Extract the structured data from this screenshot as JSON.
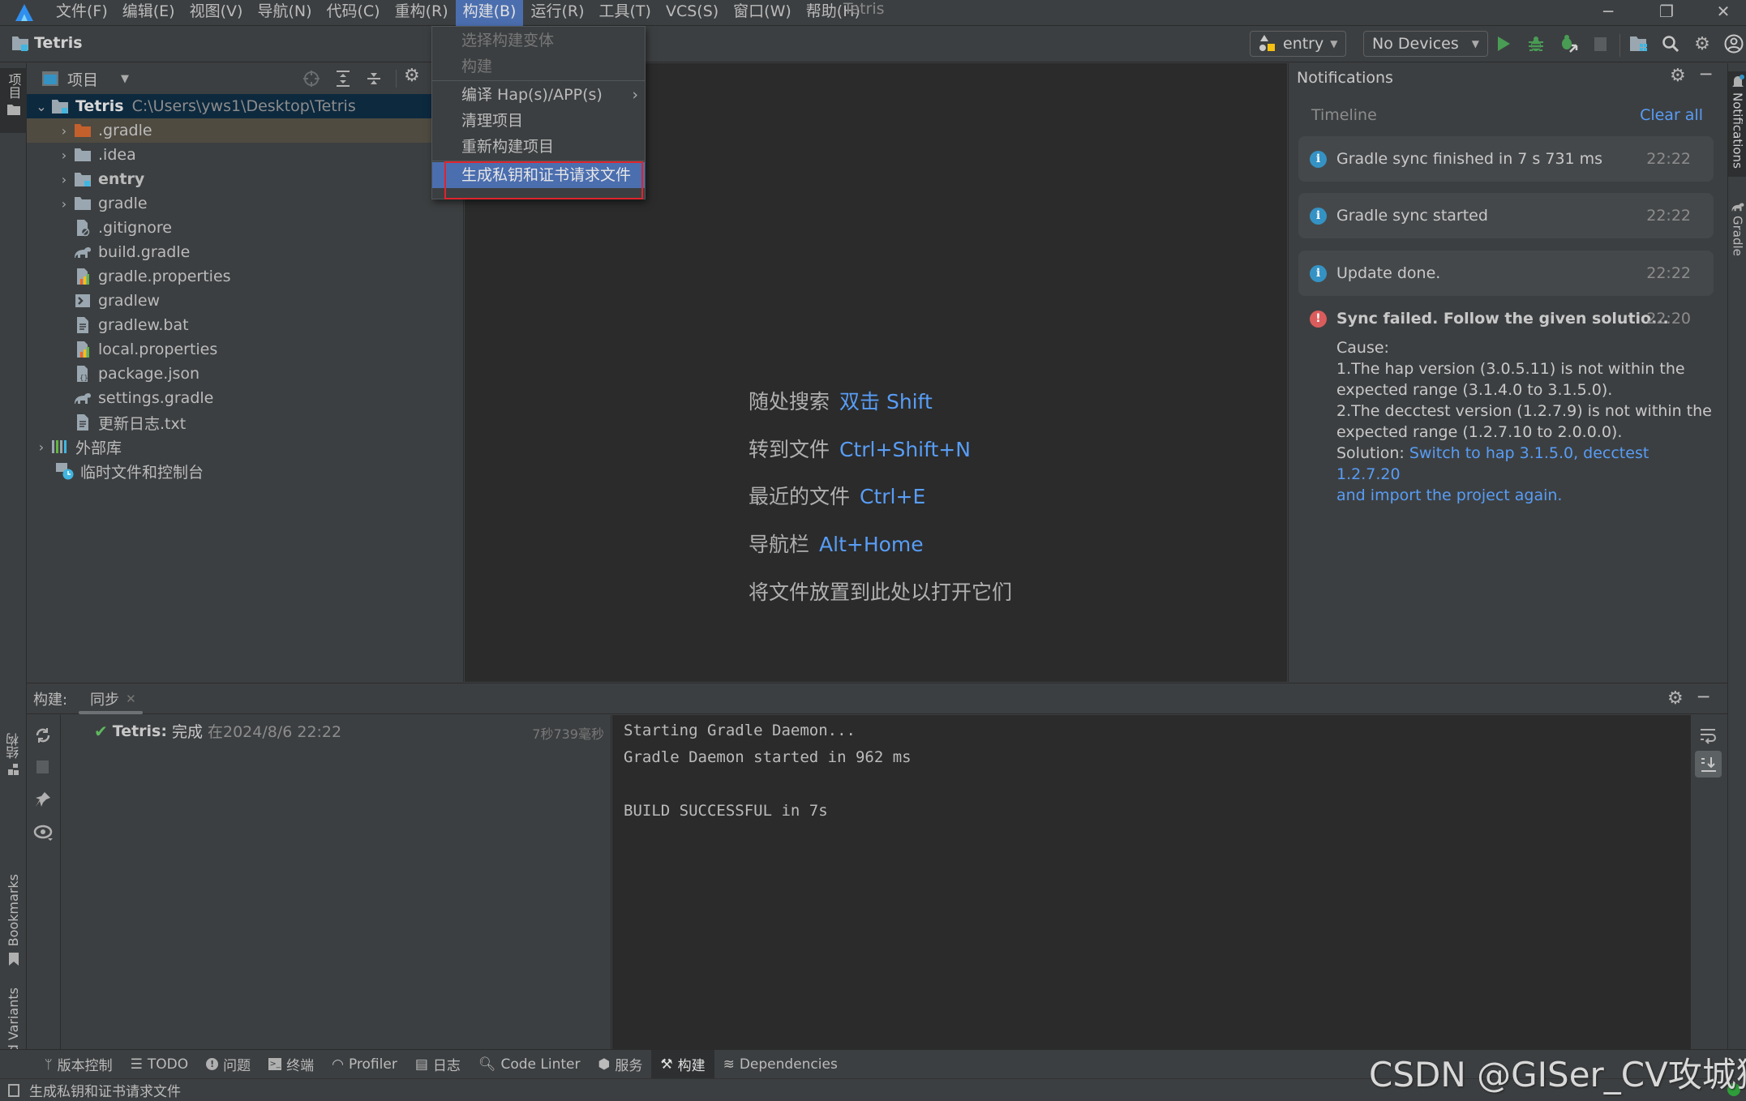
{
  "menubar": {
    "items": [
      "文件(F)",
      "编辑(E)",
      "视图(V)",
      "导航(N)",
      "代码(C)",
      "重构(R)",
      "构建(B)",
      "运行(R)",
      "工具(T)",
      "VCS(S)",
      "窗口(W)",
      "帮助(H)"
    ],
    "active_index": 6,
    "window_title": "Tetris"
  },
  "toolbar": {
    "project_name": "Tetris",
    "run_config": "entry",
    "device": "No Devices"
  },
  "build_menu": {
    "items": [
      {
        "label": "选择构建变体",
        "enabled": false
      },
      {
        "label": "构建",
        "enabled": false
      },
      {
        "label": "编译 Hap(s)/APP(s)",
        "enabled": true,
        "submenu": true
      },
      {
        "label": "清理项目",
        "enabled": true
      },
      {
        "label": "重新构建项目",
        "enabled": true
      },
      {
        "label": "生成私钥和证书请求文件",
        "enabled": true,
        "highlighted": true
      }
    ]
  },
  "project_panel": {
    "title": "项目",
    "root": {
      "name": "Tetris",
      "path": "C:\\Users\\yws1\\Desktop\\Tetris"
    },
    "items": [
      {
        "name": ".gradle",
        "type": "folder-excluded",
        "expandable": true
      },
      {
        "name": ".idea",
        "type": "folder",
        "expandable": true
      },
      {
        "name": "entry",
        "type": "module",
        "expandable": true
      },
      {
        "name": "gradle",
        "type": "folder",
        "expandable": true
      },
      {
        "name": ".gitignore",
        "type": "ignore-file"
      },
      {
        "name": "build.gradle",
        "type": "gradle-file"
      },
      {
        "name": "gradle.properties",
        "type": "properties-file"
      },
      {
        "name": "gradlew",
        "type": "script-file"
      },
      {
        "name": "gradlew.bat",
        "type": "text-file"
      },
      {
        "name": "local.properties",
        "type": "properties-file"
      },
      {
        "name": "package.json",
        "type": "json-file"
      },
      {
        "name": "settings.gradle",
        "type": "gradle-file"
      },
      {
        "name": "更新日志.txt",
        "type": "text-file"
      }
    ],
    "external_libs": "外部库",
    "scratches": "临时文件和控制台"
  },
  "left_stripe": {
    "project": "项目",
    "structure": "结构",
    "bookmarks": "Bookmarks",
    "build_variants": "Build Variants"
  },
  "right_stripe": {
    "notifications": "Notifications",
    "gradle": "Gradle"
  },
  "editor_hints": [
    {
      "label": "随处搜索",
      "key": "双击 Shift"
    },
    {
      "label": "转到文件",
      "key": "Ctrl+Shift+N"
    },
    {
      "label": "最近的文件",
      "key": "Ctrl+E"
    },
    {
      "label": "导航栏",
      "key": "Alt+Home"
    },
    {
      "label": "将文件放置到此处以打开它们",
      "key": ""
    }
  ],
  "notifications": {
    "title": "Notifications",
    "timeline": "Timeline",
    "clear_all": "Clear all",
    "items": [
      {
        "type": "info",
        "text": "Gradle sync finished in 7 s 731 ms",
        "time": "22:22"
      },
      {
        "type": "info",
        "text": "Gradle sync started",
        "time": "22:22"
      },
      {
        "type": "info",
        "text": "Update done.",
        "time": "22:22"
      }
    ],
    "error": {
      "title": "Sync failed. Follow the given solutio...",
      "time": "22:20",
      "cause_label": "Cause:",
      "lines": [
        "1.The hap version (3.0.5.11) is not within the",
        "expected range (3.1.4.0 to 3.1.5.0).",
        "2.The decctest version (1.2.7.9) is not within the",
        "expected range (1.2.7.10 to 2.0.0.0)."
      ],
      "solution_label": "Solution:",
      "solution_link_1": "Switch to hap 3.1.5.0, decctest 1.2.7.20",
      "solution_link_2": "and import the project again."
    }
  },
  "build_panel": {
    "label": "构建:",
    "tab": "同步",
    "result": {
      "project": "Tetris:",
      "status": "完成",
      "when": "在2024/8/6 22:22",
      "duration": "7秒739毫秒"
    },
    "console": [
      "Starting Gradle Daemon...",
      "Gradle Daemon started in 962 ms",
      "",
      "BUILD SUCCESSFUL in 7s"
    ]
  },
  "bottom_tabs": [
    {
      "label": "版本控制",
      "icon": "branch-icon"
    },
    {
      "label": "TODO",
      "icon": "list-icon"
    },
    {
      "label": "问题",
      "icon": "problem-icon"
    },
    {
      "label": "终端",
      "icon": "terminal-icon"
    },
    {
      "label": "Profiler",
      "icon": "profiler-icon"
    },
    {
      "label": "日志",
      "icon": "log-icon"
    },
    {
      "label": "Code Linter",
      "icon": "linter-icon"
    },
    {
      "label": "服务",
      "icon": "services-icon"
    },
    {
      "label": "构建",
      "icon": "hammer-icon",
      "active": true
    },
    {
      "label": "Dependencies",
      "icon": "layers-icon"
    }
  ],
  "statusbar": {
    "message": "生成私钥和证书请求文件"
  },
  "watermark": "CSDN @GISer_CV攻城狮",
  "colors": {
    "accent": "#4b6eaf",
    "link": "#589df6",
    "run_green": "#499c54",
    "error_red": "#db5c5c",
    "info_blue": "#3592c4",
    "highlight_box": "#e0232d"
  }
}
